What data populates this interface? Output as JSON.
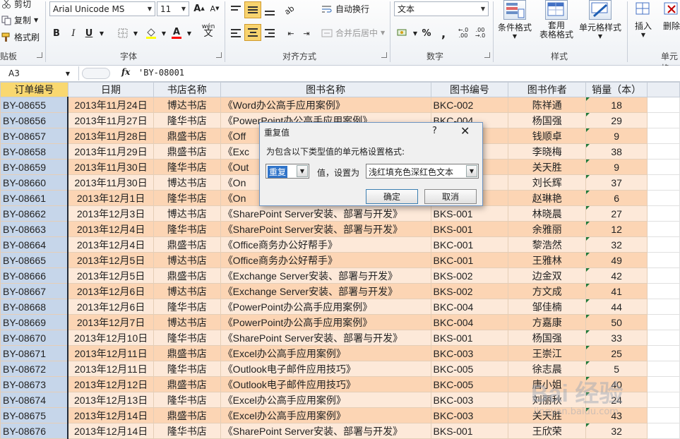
{
  "ribbon": {
    "clipboard": {
      "cut": "剪切",
      "copy": "复制",
      "format_painter": "格式刷",
      "group_label": "贴板"
    },
    "font": {
      "font_name": "Arial Unicode MS",
      "font_size": "11",
      "group_label": "字体",
      "bold": "B",
      "italic": "I",
      "underline": "U",
      "grow": "A",
      "shrink": "A",
      "phonetic": "wén",
      "font_color": "#ff0000",
      "fill_color": "#ffff00"
    },
    "alignment": {
      "wrap_text": "自动换行",
      "merge_center": "合并后居中",
      "group_label": "对齐方式"
    },
    "number": {
      "format": "文本",
      "percent": "%",
      "comma": ",",
      "group_label": "数字"
    },
    "styles": {
      "conditional_format": "条件格式",
      "table_format_line1": "套用",
      "table_format_line2": "表格格式",
      "cell_styles": "单元格样式",
      "group_label": "样式"
    },
    "cells": {
      "insert": "插入",
      "delete": "删除",
      "group_label": "单元格"
    }
  },
  "formula_bar": {
    "name_box": "A3",
    "fx": "fx",
    "formula": "'BY-08001"
  },
  "sheet": {
    "headers": [
      "订单编号",
      "日期",
      "书店名称",
      "图书名称",
      "图书编号",
      "图书作者",
      "销量（本）"
    ],
    "rows": [
      [
        "BY-08655",
        "2013年11月24日",
        "博达书店",
        "《Word办公高手应用案例》",
        "BKC-002",
        "陈祥通",
        "18"
      ],
      [
        "BY-08656",
        "2013年11月27日",
        "隆华书店",
        "《PowerPoint办公高手应用案例》",
        "BKC-004",
        "杨国强",
        "29"
      ],
      [
        "BY-08657",
        "2013年11月28日",
        "鼎盛书店",
        "《Off",
        "01",
        "钱顺卓",
        "9"
      ],
      [
        "BY-08658",
        "2013年11月29日",
        "鼎盛书店",
        "《Exc",
        "03",
        "李晓梅",
        "38"
      ],
      [
        "BY-08659",
        "2013年11月30日",
        "隆华书店",
        "《Out",
        "05",
        "关天胜",
        "9"
      ],
      [
        "BY-08660",
        "2013年11月30日",
        "博达书店",
        "《On",
        "06",
        "刘长辉",
        "37"
      ],
      [
        "BY-08661",
        "2013年12月1日",
        "隆华书店",
        "《On",
        "06",
        "赵琳艳",
        "6"
      ],
      [
        "BY-08662",
        "2013年12月3日",
        "博达书店",
        "《SharePoint Server安装、部署与开发》",
        "BKS-001",
        "林晓晨",
        "27"
      ],
      [
        "BY-08663",
        "2013年12月4日",
        "隆华书店",
        "《SharePoint Server安装、部署与开发》",
        "BKS-001",
        "余雅丽",
        "12"
      ],
      [
        "BY-08664",
        "2013年12月4日",
        "鼎盛书店",
        "《Office商务办公好帮手》",
        "BKC-001",
        "黎浩然",
        "32"
      ],
      [
        "BY-08665",
        "2013年12月5日",
        "博达书店",
        "《Office商务办公好帮手》",
        "BKC-001",
        "王雅林",
        "49"
      ],
      [
        "BY-08666",
        "2013年12月5日",
        "鼎盛书店",
        "《Exchange Server安装、部署与开发》",
        "BKS-002",
        "边金双",
        "42"
      ],
      [
        "BY-08667",
        "2013年12月6日",
        "博达书店",
        "《Exchange Server安装、部署与开发》",
        "BKS-002",
        "方文成",
        "41"
      ],
      [
        "BY-08668",
        "2013年12月6日",
        "隆华书店",
        "《PowerPoint办公高手应用案例》",
        "BKC-004",
        "邹佳楠",
        "44"
      ],
      [
        "BY-08669",
        "2013年12月7日",
        "博达书店",
        "《PowerPoint办公高手应用案例》",
        "BKC-004",
        "方嘉康",
        "50"
      ],
      [
        "BY-08670",
        "2013年12月10日",
        "隆华书店",
        "《SharePoint Server安装、部署与开发》",
        "BKS-001",
        "杨国强",
        "33"
      ],
      [
        "BY-08671",
        "2013年12月11日",
        "鼎盛书店",
        "《Excel办公高手应用案例》",
        "BKC-003",
        "王崇江",
        "25"
      ],
      [
        "BY-08672",
        "2013年12月11日",
        "隆华书店",
        "《Outlook电子邮件应用技巧》",
        "BKC-005",
        "徐志晨",
        "5"
      ],
      [
        "BY-08673",
        "2013年12月12日",
        "鼎盛书店",
        "《Outlook电子邮件应用技巧》",
        "BKC-005",
        "唐小姐",
        "40"
      ],
      [
        "BY-08674",
        "2013年12月13日",
        "隆华书店",
        "《Excel办公高手应用案例》",
        "BKC-003",
        "刘丽秋",
        "24"
      ],
      [
        "BY-08675",
        "2013年12月14日",
        "鼎盛书店",
        "《Excel办公高手应用案例》",
        "BKC-003",
        "关天胜",
        "43"
      ],
      [
        "BY-08676",
        "2013年12月14日",
        "隆华书店",
        "《SharePoint Server安装、部署与开发》",
        "BKS-001",
        "王欣荣",
        "32"
      ]
    ]
  },
  "dialog": {
    "title": "重复值",
    "help": "?",
    "close": "✕",
    "description": "为包含以下类型值的单元格设置格式:",
    "type_value": "重复",
    "middle_text": "值，设置为",
    "format_value": "浅红填充色深红色文本",
    "ok": "确定",
    "cancel": "取消"
  },
  "watermark": {
    "main": "Bai 经验",
    "sub": "jingyan.baidu.com"
  }
}
